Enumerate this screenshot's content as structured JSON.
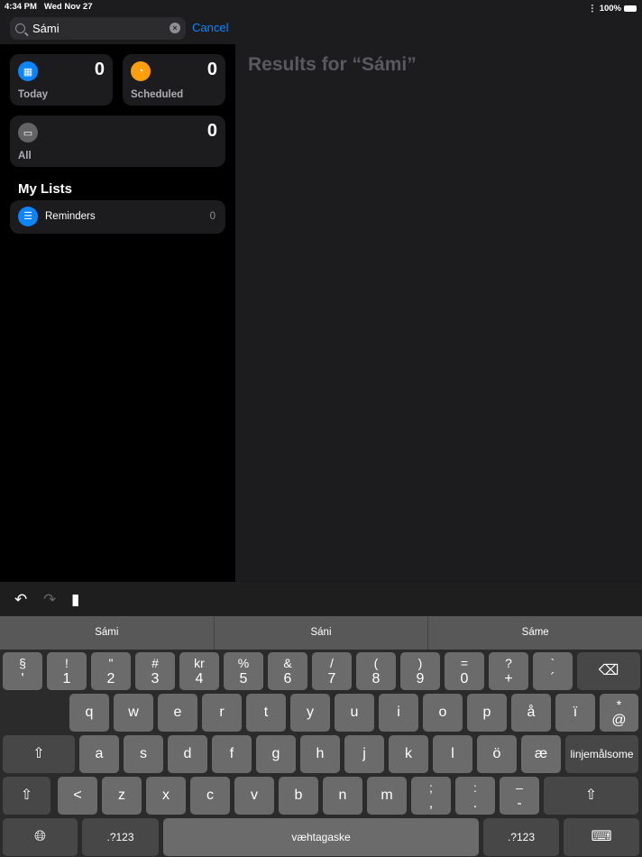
{
  "status": {
    "time": "4:34 PM",
    "date": "Wed Nov 27",
    "battery": "100%"
  },
  "search": {
    "value": "Sámi",
    "cancel": "Cancel"
  },
  "smart_lists": [
    {
      "label": "Today",
      "count": "0",
      "color": "#0a84ff"
    },
    {
      "label": "Scheduled",
      "count": "0",
      "color": "#ff9f0a"
    },
    {
      "label": "All",
      "count": "0",
      "color": "#636366"
    }
  ],
  "my_lists": {
    "title": "My Lists",
    "items": [
      {
        "name": "Reminders",
        "count": "0"
      }
    ]
  },
  "results_title": "Results for “Sámi”",
  "suggestions": [
    "Sámi",
    "Sáni",
    "Sáme"
  ],
  "keyboard": {
    "row1": [
      [
        "§",
        "'"
      ],
      [
        "!",
        "1"
      ],
      [
        "\"",
        "2"
      ],
      [
        "#",
        "3"
      ],
      [
        "kr",
        "4"
      ],
      [
        "%",
        "5"
      ],
      [
        "&",
        "6"
      ],
      [
        "/",
        "7"
      ],
      [
        "(",
        "8"
      ],
      [
        ")",
        "9"
      ],
      [
        "=",
        "0"
      ],
      [
        "?",
        "+"
      ],
      [
        "`",
        "´"
      ]
    ],
    "row2": [
      "q",
      "w",
      "e",
      "r",
      "t",
      "y",
      "u",
      "i",
      "o",
      "p",
      "å",
      "ï"
    ],
    "row2_last": [
      "*",
      "@"
    ],
    "row3": [
      "a",
      "s",
      "d",
      "f",
      "g",
      "h",
      "j",
      "k",
      "l",
      "ö",
      "æ"
    ],
    "return_label": "linjemålsome",
    "row4": [
      "<",
      "z",
      "x",
      "c",
      "v",
      "b",
      "n",
      "m"
    ],
    "row4_punct": [
      [
        ";",
        ","
      ],
      [
        ":",
        "."
      ],
      [
        "–",
        "-"
      ]
    ],
    "numbers_label": ".?123",
    "space_label": "væhtagaske"
  }
}
